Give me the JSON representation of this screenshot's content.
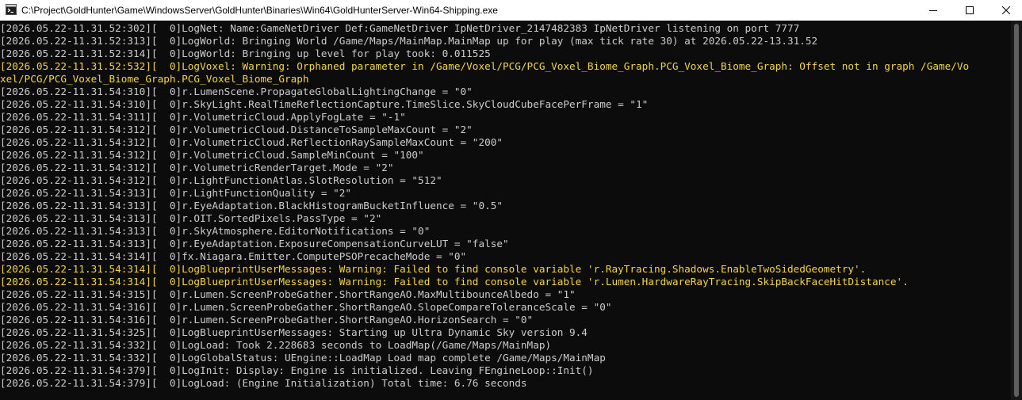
{
  "window": {
    "title": "C:\\Project\\GoldHunter\\Game\\WindowsServer\\GoldHunter\\Binaries\\Win64\\GoldHunterServer-Win64-Shipping.exe",
    "icons": {
      "app": "console-app-icon",
      "minimize": "minimize-icon",
      "maximize": "maximize-icon",
      "close": "close-icon"
    }
  },
  "colors": {
    "background": "#0c0c0c",
    "text": "#cccccc",
    "warning": "#f5d442",
    "titlebar": "#ffffff"
  },
  "console": {
    "lines": [
      {
        "text": "[2026.05.22-11.31.52:302][  0]LogNet: Name:GameNetDriver Def:GameNetDriver IpNetDriver_2147482383 IpNetDriver listening on port 7777",
        "level": "info"
      },
      {
        "text": "[2026.05.22-11.31.52:313][  0]LogWorld: Bringing World /Game/Maps/MainMap.MainMap up for play (max tick rate 30) at 2026.05.22-13.31.52",
        "level": "info"
      },
      {
        "text": "[2026.05.22-11.31.52:314][  0]LogWorld: Bringing up level for play took: 0.011525",
        "level": "info"
      },
      {
        "text": "[2026.05.22-11.31.52:532][  0]LogVoxel: Warning: Orphaned parameter in /Game/Voxel/PCG/PCG_Voxel_Biome_Graph.PCG_Voxel_Biome_Graph: Offset not in graph /Game/Vo",
        "level": "warning"
      },
      {
        "text": "xel/PCG/PCG_Voxel_Biome_Graph.PCG_Voxel_Biome_Graph",
        "level": "warning"
      },
      {
        "text": "[2026.05.22-11.31.54:310][  0]r.LumenScene.PropagateGlobalLightingChange = \"0\"",
        "level": "info"
      },
      {
        "text": "[2026.05.22-11.31.54:310][  0]r.SkyLight.RealTimeReflectionCapture.TimeSlice.SkyCloudCubeFacePerFrame = \"1\"",
        "level": "info"
      },
      {
        "text": "[2026.05.22-11.31.54:311][  0]r.VolumetricCloud.ApplyFogLate = \"-1\"",
        "level": "info"
      },
      {
        "text": "[2026.05.22-11.31.54:312][  0]r.VolumetricCloud.DistanceToSampleMaxCount = \"2\"",
        "level": "info"
      },
      {
        "text": "[2026.05.22-11.31.54:312][  0]r.VolumetricCloud.ReflectionRaySampleMaxCount = \"200\"",
        "level": "info"
      },
      {
        "text": "[2026.05.22-11.31.54:312][  0]r.VolumetricCloud.SampleMinCount = \"100\"",
        "level": "info"
      },
      {
        "text": "[2026.05.22-11.31.54:312][  0]r.VolumetricRenderTarget.Mode = \"2\"",
        "level": "info"
      },
      {
        "text": "[2026.05.22-11.31.54:312][  0]r.LightFunctionAtlas.SlotResolution = \"512\"",
        "level": "info"
      },
      {
        "text": "[2026.05.22-11.31.54:313][  0]r.LightFunctionQuality = \"2\"",
        "level": "info"
      },
      {
        "text": "[2026.05.22-11.31.54:313][  0]r.EyeAdaptation.BlackHistogramBucketInfluence = \"0.5\"",
        "level": "info"
      },
      {
        "text": "[2026.05.22-11.31.54:313][  0]r.OIT.SortedPixels.PassType = \"2\"",
        "level": "info"
      },
      {
        "text": "[2026.05.22-11.31.54:313][  0]r.SkyAtmosphere.EditorNotifications = \"0\"",
        "level": "info"
      },
      {
        "text": "[2026.05.22-11.31.54:313][  0]r.EyeAdaptation.ExposureCompensationCurveLUT = \"false\"",
        "level": "info"
      },
      {
        "text": "[2026.05.22-11.31.54:314][  0]fx.Niagara.Emitter.ComputePSOPrecacheMode = \"0\"",
        "level": "info"
      },
      {
        "text": "[2026.05.22-11.31.54:314][  0]LogBlueprintUserMessages: Warning: Failed to find console variable 'r.RayTracing.Shadows.EnableTwoSidedGeometry'.",
        "level": "warning"
      },
      {
        "text": "[2026.05.22-11.31.54:314][  0]LogBlueprintUserMessages: Warning: Failed to find console variable 'r.Lumen.HardwareRayTracing.SkipBackFaceHitDistance'.",
        "level": "warning"
      },
      {
        "text": "[2026.05.22-11.31.54:315][  0]r.Lumen.ScreenProbeGather.ShortRangeAO.MaxMultibounceAlbedo = \"1\"",
        "level": "info"
      },
      {
        "text": "[2026.05.22-11.31.54:316][  0]r.Lumen.ScreenProbeGather.ShortRangeAO.SlopeCompareToleranceScale = \"0\"",
        "level": "info"
      },
      {
        "text": "[2026.05.22-11.31.54:316][  0]r.Lumen.ScreenProbeGather.ShortRangeAO.HorizonSearch = \"0\"",
        "level": "info"
      },
      {
        "text": "[2026.05.22-11.31.54:325][  0]LogBlueprintUserMessages: Starting up Ultra Dynamic Sky version 9.4",
        "level": "info"
      },
      {
        "text": "[2026.05.22-11.31.54:332][  0]LogLoad: Took 2.228683 seconds to LoadMap(/Game/Maps/MainMap)",
        "level": "info"
      },
      {
        "text": "[2026.05.22-11.31.54:332][  0]LogGlobalStatus: UEngine::LoadMap Load map complete /Game/Maps/MainMap",
        "level": "info"
      },
      {
        "text": "[2026.05.22-11.31.54:379][  0]LogInit: Display: Engine is initialized. Leaving FEngineLoop::Init()",
        "level": "info"
      },
      {
        "text": "[2026.05.22-11.31.54:379][  0]LogLoad: (Engine Initialization) Total time: 6.76 seconds",
        "level": "info"
      }
    ]
  }
}
